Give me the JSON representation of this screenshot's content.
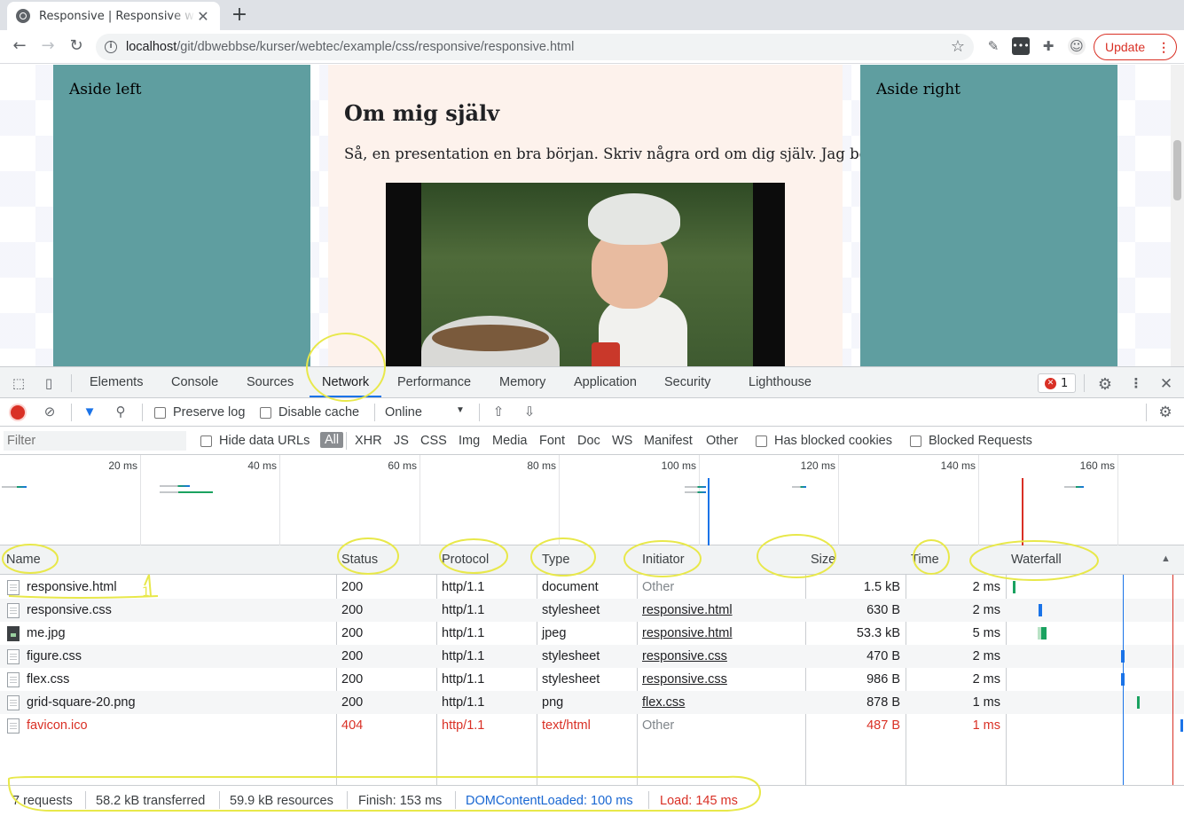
{
  "browser": {
    "tab_title": "Responsive | Responsive w",
    "tab_close": "✕",
    "new_tab": "+",
    "url_host": "localhost",
    "url_path": "/git/dbwebbse/kurser/webtec/example/css/responsive/responsive.html",
    "update_label": "Update",
    "update_menu": "⋮"
  },
  "page": {
    "aside_left": "Aside left",
    "aside_right": "Aside right",
    "heading": "Om mig själv",
    "paragraph": "Så, en presentation en bra början. Skriv några ord om dig själv. Jag börjar."
  },
  "devtools": {
    "tabs": [
      "Elements",
      "Console",
      "Sources",
      "Network",
      "Performance",
      "Memory",
      "Application",
      "Security",
      "Lighthouse"
    ],
    "active_tab": "Network",
    "error_count": "1",
    "preserve_log": "Preserve log",
    "disable_cache": "Disable cache",
    "throttle": "Online",
    "filter_placeholder": "Filter",
    "hide_data_urls": "Hide data URLs",
    "filter_types": [
      "All",
      "XHR",
      "JS",
      "CSS",
      "Img",
      "Media",
      "Font",
      "Doc",
      "WS",
      "Manifest",
      "Other"
    ],
    "has_blocked_cookies": "Has blocked cookies",
    "blocked_requests": "Blocked Requests",
    "timeline_labels": [
      "20 ms",
      "40 ms",
      "60 ms",
      "80 ms",
      "100 ms",
      "120 ms",
      "140 ms",
      "160 ms"
    ],
    "columns": [
      "Name",
      "Status",
      "Protocol",
      "Type",
      "Initiator",
      "Size",
      "Time",
      "Waterfall"
    ],
    "rows": [
      {
        "name": "responsive.html",
        "status": "200",
        "protocol": "http/1.1",
        "type": "document",
        "initiator": "Other",
        "size": "1.5 kB",
        "time": "2 ms"
      },
      {
        "name": "responsive.css",
        "status": "200",
        "protocol": "http/1.1",
        "type": "stylesheet",
        "initiator": "responsive.html",
        "size": "630 B",
        "time": "2 ms"
      },
      {
        "name": "me.jpg",
        "status": "200",
        "protocol": "http/1.1",
        "type": "jpeg",
        "initiator": "responsive.html",
        "size": "53.3 kB",
        "time": "5 ms"
      },
      {
        "name": "figure.css",
        "status": "200",
        "protocol": "http/1.1",
        "type": "stylesheet",
        "initiator": "responsive.css",
        "size": "470 B",
        "time": "2 ms"
      },
      {
        "name": "flex.css",
        "status": "200",
        "protocol": "http/1.1",
        "type": "stylesheet",
        "initiator": "responsive.css",
        "size": "986 B",
        "time": "2 ms"
      },
      {
        "name": "grid-square-20.png",
        "status": "200",
        "protocol": "http/1.1",
        "type": "png",
        "initiator": "flex.css",
        "size": "878 B",
        "time": "1 ms"
      },
      {
        "name": "favicon.ico",
        "status": "404",
        "protocol": "http/1.1",
        "type": "text/html",
        "initiator": "Other",
        "size": "487 B",
        "time": "1 ms"
      }
    ],
    "summary": {
      "requests": "7 requests",
      "transferred": "58.2 kB transferred",
      "resources": "59.9 kB resources",
      "finish": "Finish: 153 ms",
      "dom_content_loaded": "DOMContentLoaded: 100 ms",
      "load": "Load: 145 ms"
    }
  },
  "annotation": {
    "row_marker": "1",
    "color": "#e8e84a"
  },
  "colors": {
    "aside": "#5f9ea0",
    "main_bg": "#fdf2ec",
    "accent": "#1a73e8",
    "error": "#d93025"
  }
}
